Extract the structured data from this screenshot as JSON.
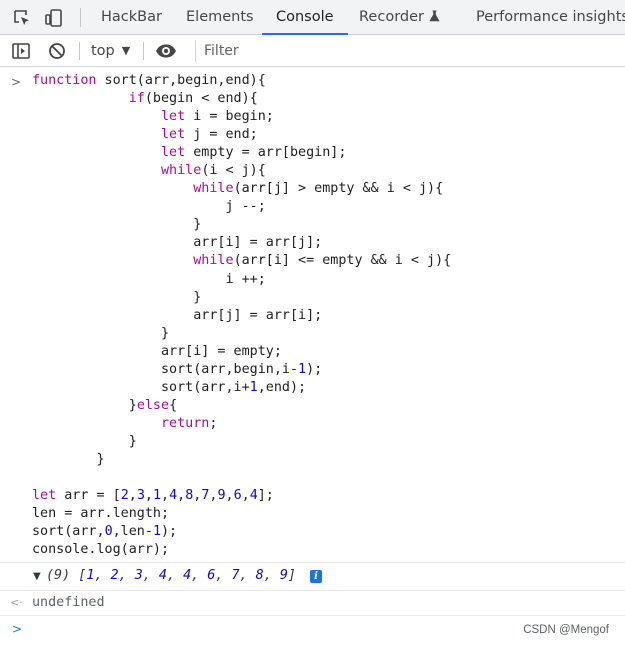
{
  "tabbar": {
    "icons": [
      "inspect-element-icon",
      "device-toolbar-icon"
    ],
    "tabs": [
      {
        "label": "HackBar",
        "active": false
      },
      {
        "label": "Elements",
        "active": false
      },
      {
        "label": "Console",
        "active": true
      },
      {
        "label": "Recorder",
        "active": false,
        "icon": "flask-icon"
      },
      {
        "label": "Performance insights",
        "active": false
      }
    ]
  },
  "toolbar": {
    "icons": [
      "show-sidebar-icon",
      "clear-console-icon",
      "live-expression-eye-icon"
    ],
    "context_label": "top",
    "filter_placeholder": "Filter",
    "filter_value": ""
  },
  "console": {
    "input_lines": [
      "function sort(arr,begin,end){",
      "            if(begin < end){",
      "                let i = begin;",
      "                let j = end;",
      "                let empty = arr[begin];",
      "                while(i < j){",
      "                    while(arr[j] > empty && i < j){",
      "                        j --;",
      "                    }",
      "                    arr[i] = arr[j];",
      "                    while(arr[i] <= empty && i < j){",
      "                        i ++;",
      "                    }",
      "                    arr[j] = arr[i];",
      "                }",
      "                arr[i] = empty;",
      "                sort(arr,begin,i-1);",
      "                sort(arr,i+1,end);",
      "            }else{",
      "                return;",
      "            }",
      "        }",
      "",
      "let arr = [2,3,1,4,8,7,9,6,4];",
      "len = arr.length;",
      "sort(arr,0,len-1);",
      "console.log(arr);"
    ],
    "keywords": [
      "function",
      "if",
      "let",
      "while",
      "else",
      "return"
    ],
    "log_output": {
      "length_label": "(9)",
      "values": [
        1,
        2,
        3,
        4,
        4,
        6,
        7,
        8,
        9
      ]
    },
    "return_value": "undefined"
  },
  "watermark": "CSDN @Mengof",
  "colors": {
    "keyword": "#aa0d91",
    "number": "#1c00cf",
    "accent": "#1a73e8"
  }
}
